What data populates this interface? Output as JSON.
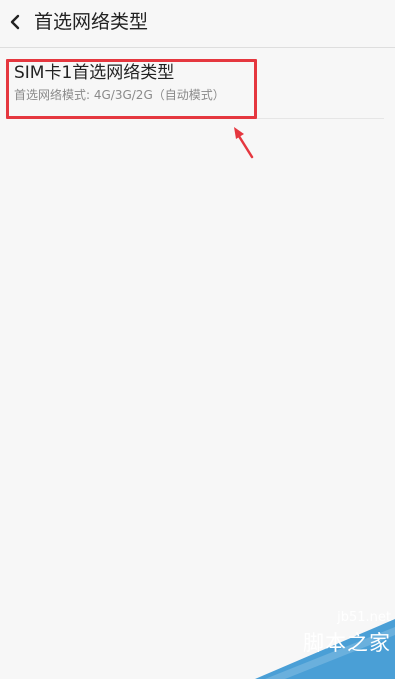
{
  "header": {
    "title": "首选网络类型",
    "back_icon": "chevron-left-icon"
  },
  "setting": {
    "title": "SIM卡1首选网络类型",
    "subtitle": "首选网络模式: 4G/3G/2G（自动模式）"
  },
  "annotation": {
    "box_color": "#e5373f",
    "arrow_color": "#e5373f"
  },
  "watermark": {
    "site": "jb51.net",
    "name": "脚本之家",
    "color": "#4a9fd6"
  }
}
